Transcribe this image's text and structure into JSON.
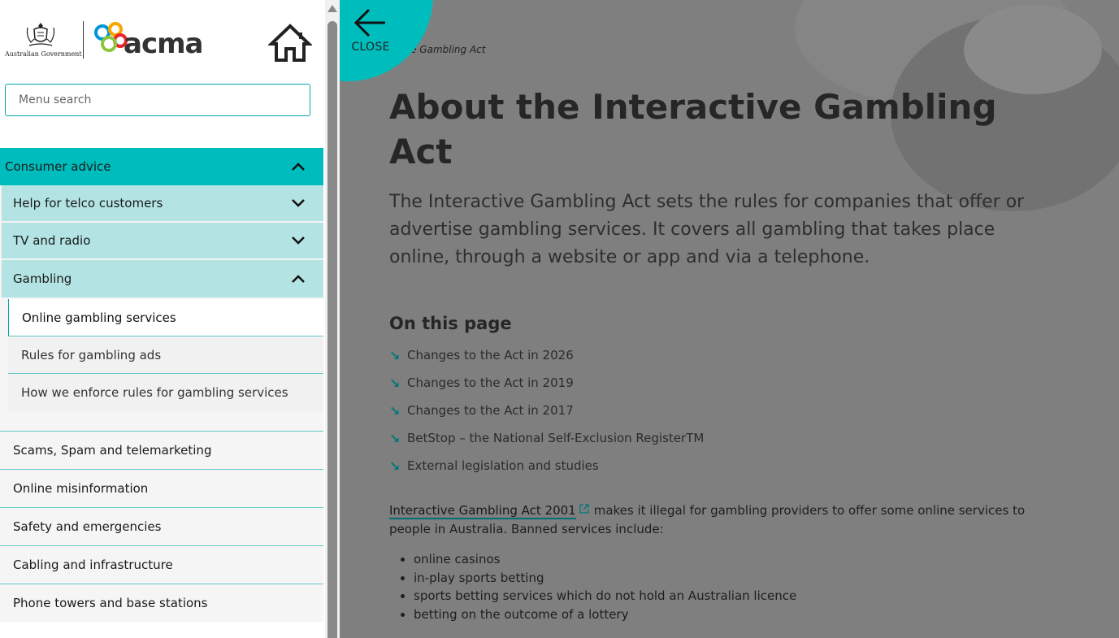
{
  "header": {
    "govt_label": "Australian Government",
    "acma_label": "acma"
  },
  "search": {
    "placeholder": "Menu search",
    "value": ""
  },
  "nav": {
    "parent": "Consumer advice",
    "subsections": [
      "Help for telco customers",
      "TV and radio",
      "Gambling"
    ],
    "gambling_items": [
      "Online gambling services",
      "Rules for gambling ads",
      "How we enforce rules for gambling services"
    ],
    "other_items": [
      "Scams, Spam and telemarketing",
      "Online misinformation",
      "Safety and emergencies",
      "Cabling and infrastructure",
      "Phone towers and base stations"
    ]
  },
  "close": {
    "label": "CLOSE"
  },
  "content": {
    "breadcrumb": "ve Gambling Act",
    "title": "About the Interactive Gambling Act",
    "lead": "The Interactive Gambling Act sets the rules for companies that offer or advertise gambling services. It covers all gambling that takes place online, through a website or app and via a telephone.",
    "on_this_page_title": "On this page",
    "on_this_page": [
      "Changes to the Act in 2026",
      "Changes to the Act in 2019",
      "Changes to the Act in 2017",
      "BetStop – the National Self-Exclusion RegisterTM",
      "External legislation and studies"
    ],
    "act_link": "Interactive Gambling Act 2001",
    "body_text": "makes it illegal for gambling providers to offer some online services to people in Australia. Banned services include:",
    "banned": [
      "online casinos",
      "in-play sports betting",
      "sports betting services which do not hold an Australian licence",
      "betting on the outcome of a lottery"
    ]
  },
  "colors": {
    "accent": "#00bdbd",
    "sub_bg": "#b3e3e3",
    "link_underline": "#006e72"
  }
}
